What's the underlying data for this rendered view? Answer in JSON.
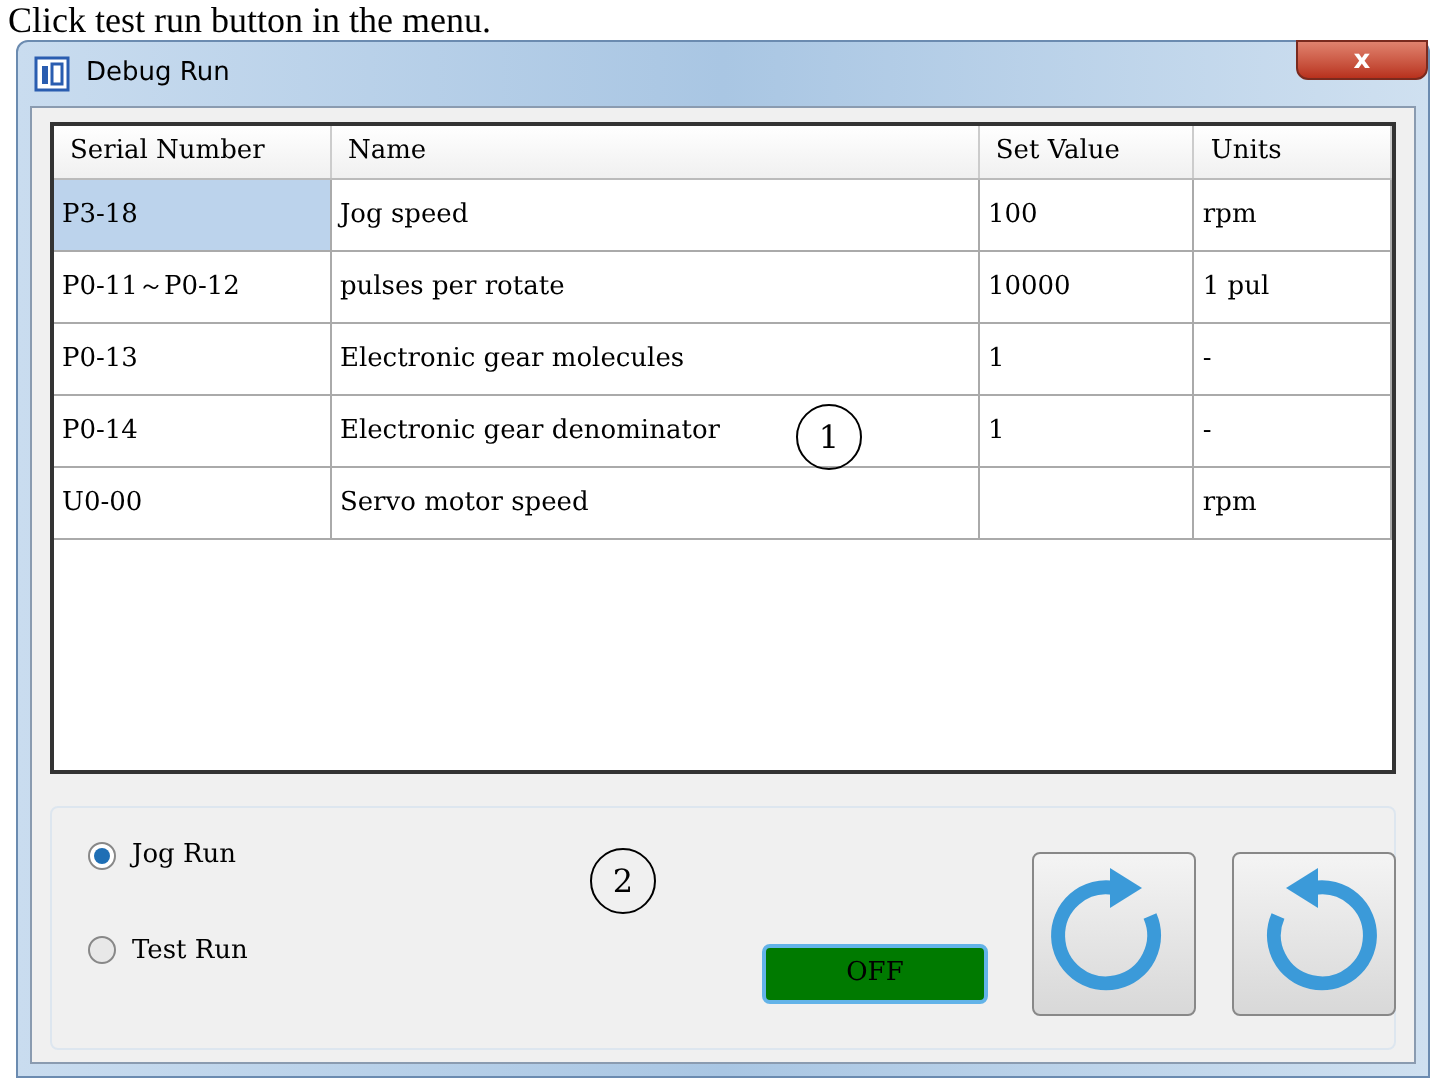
{
  "caption": "Click test run button in the menu.",
  "window": {
    "title": "Debug Run",
    "close": "x"
  },
  "table": {
    "columns": [
      "Serial Number",
      "Name",
      "Set Value",
      "Units"
    ],
    "rows": [
      {
        "cells": [
          "P3-18",
          "Jog speed",
          "100",
          "rpm"
        ],
        "selected": true
      },
      {
        "cells": [
          "P0-11～P0-12",
          "pulses per rotate",
          "10000",
          "1 pul"
        ],
        "selected": false
      },
      {
        "cells": [
          "P0-13",
          "Electronic gear molecules",
          "1",
          "-"
        ],
        "selected": false
      },
      {
        "cells": [
          "P0-14",
          "Electronic gear denominator",
          "1",
          "-"
        ],
        "selected": false
      },
      {
        "cells": [
          "U0-00",
          "Servo motor speed",
          "",
          "rpm"
        ],
        "selected": false
      }
    ]
  },
  "modes": [
    {
      "label": "Jog Run",
      "selected": true
    },
    {
      "label": "Test Run",
      "selected": false
    }
  ],
  "status": {
    "label": "OFF",
    "on": false
  },
  "annotations": [
    "1",
    "2"
  ]
}
